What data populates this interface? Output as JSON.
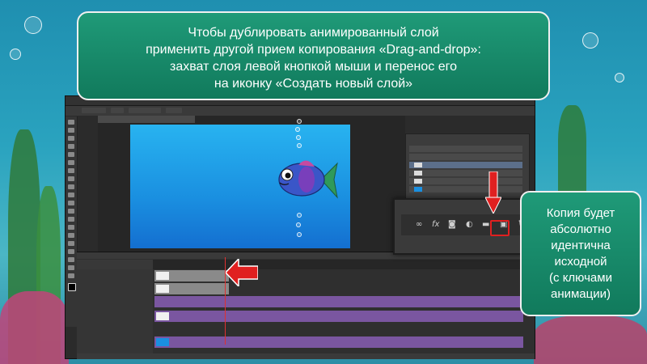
{
  "callout_top": {
    "lines": [
      "Чтобы дублировать анимированный слой",
      "применить другой прием копирования «Drag-and-drop»:",
      "захват слоя левой кнопкой мыши и перенос его",
      "на иконку «Создать новый слой»"
    ]
  },
  "callout_right": {
    "lines": [
      "Копия будет",
      "абсолютно",
      "идентична",
      "исходной",
      "(с ключами",
      "анимации)"
    ]
  },
  "inset_panel": {
    "icons": [
      "link-icon",
      "fx-icon",
      "mask-icon",
      "adjustment-icon",
      "folder-icon",
      "new-layer-icon",
      "trash-icon"
    ],
    "fx_label": "fx"
  },
  "colors": {
    "callout_bg": "#188a6a",
    "arrow": "#e02020",
    "track": "#7a56a0",
    "canvas": "#1a8fe0"
  }
}
